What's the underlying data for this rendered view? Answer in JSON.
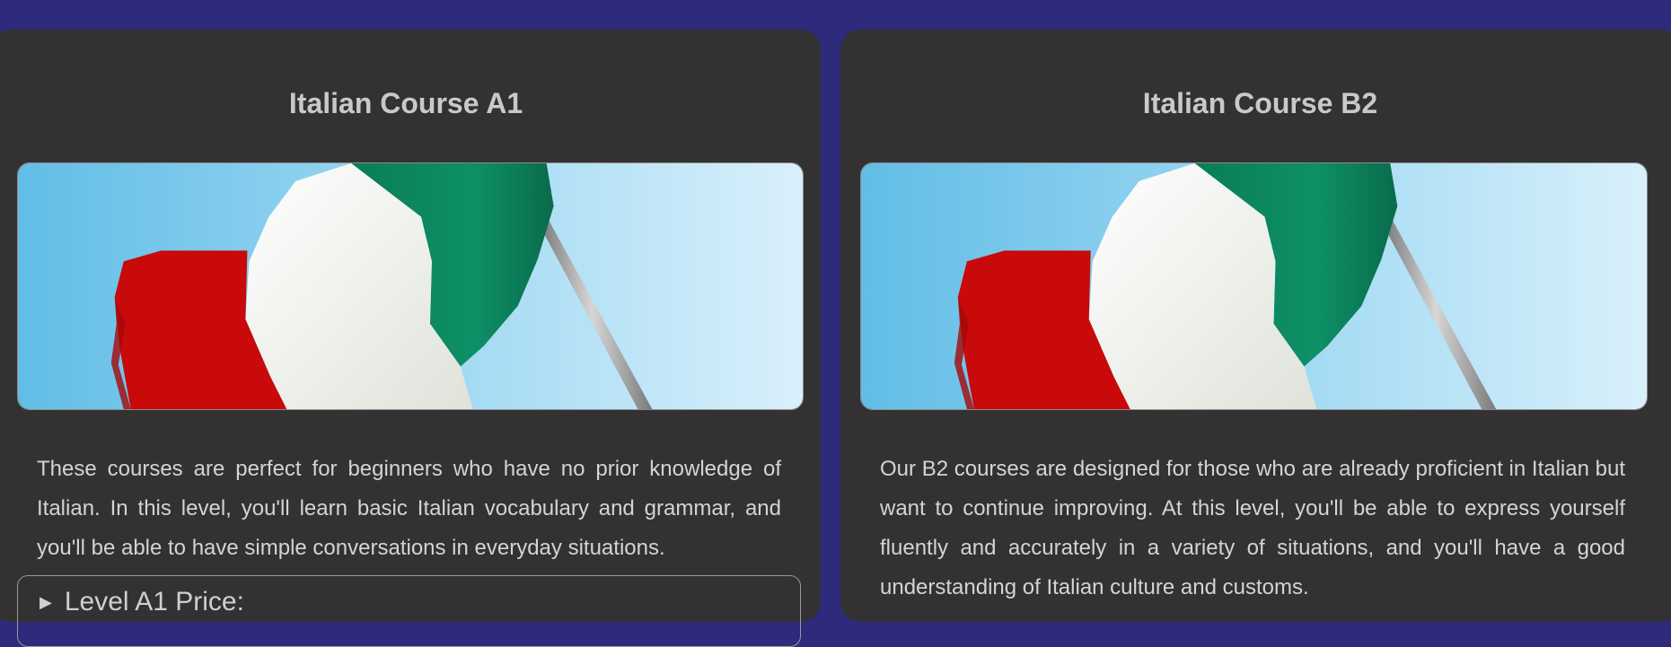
{
  "courses": [
    {
      "title": "Italian Course A1",
      "description": "These courses are perfect for beginners who have no prior knowledge of Italian. In this level, you'll learn basic Italian vocabulary and grammar, and you'll be able to have simple conversations in everyday situations.",
      "price_toggle_label": "Level A1 Price:"
    },
    {
      "title": "Italian Course B2",
      "description": "Our B2 courses are designed for those who are already proficient in Italian but want to continue improving. At this level, you'll be able to express yourself fluently and accurately in a variety of situations, and you'll have a good understanding of Italian culture and customs."
    }
  ],
  "colors": {
    "page_background": "#2e2a7c",
    "card_background": "#333132",
    "flag_green": "#0b8a63",
    "flag_white": "#eef0ea",
    "flag_red": "#c80a0a",
    "sky": "#8fd0ee"
  }
}
